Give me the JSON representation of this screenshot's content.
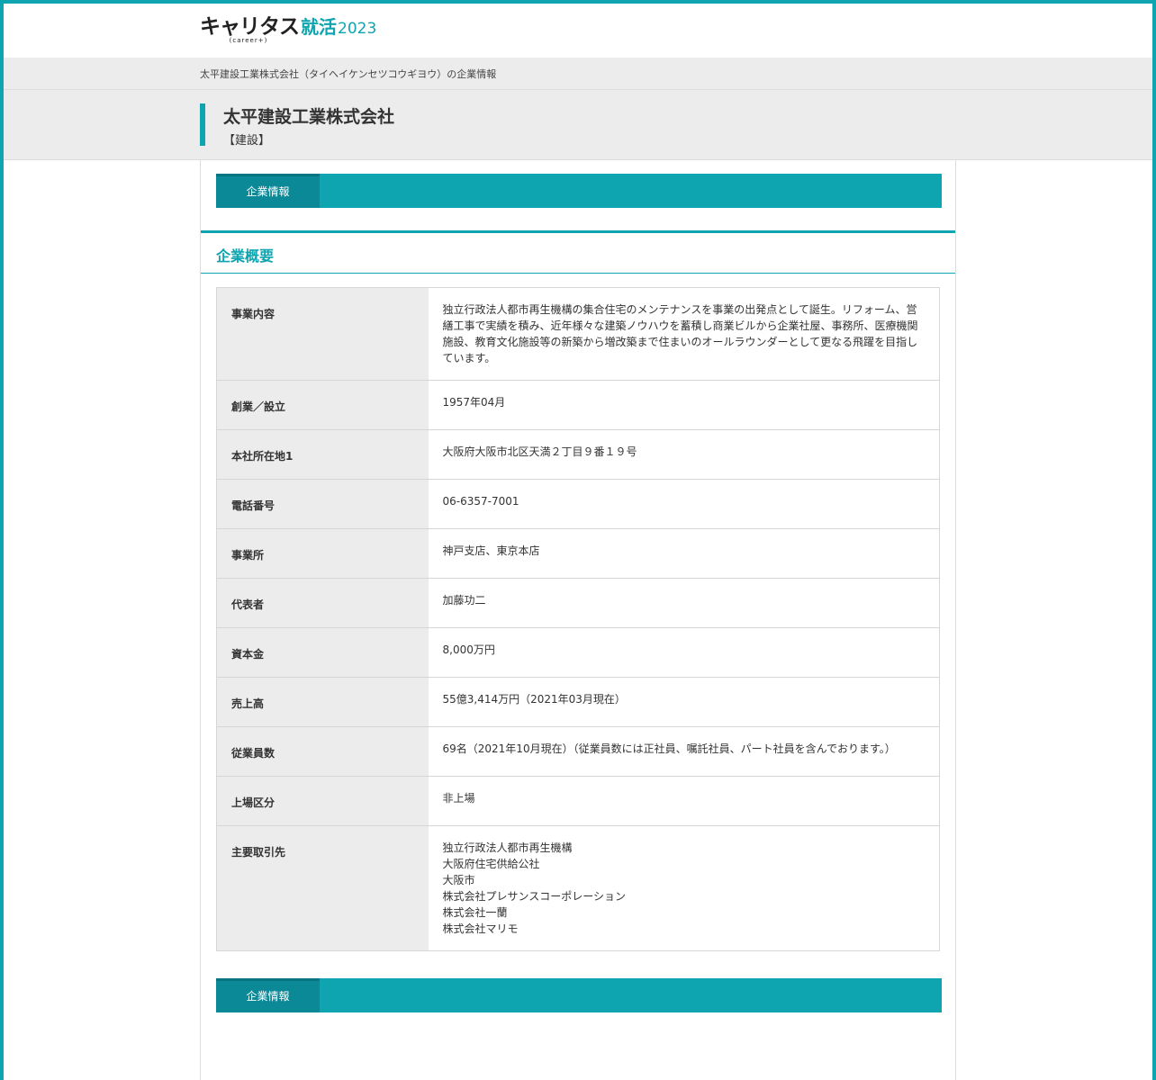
{
  "header": {
    "logo_main": "キャリタス",
    "logo_sub": "(career+)",
    "logo_accent": "就活",
    "logo_year": "2023"
  },
  "breadcrumb": "太平建設工業株式会社（タイヘイケンセツコウギヨウ）の企業情報",
  "company": {
    "name": "太平建設工業株式会社",
    "industry": "【建設】"
  },
  "tabs": {
    "top_label": "企業情報",
    "bottom_label": "企業情報"
  },
  "section": {
    "title": "企業概要"
  },
  "overview": {
    "rows": [
      {
        "label": "事業内容",
        "lines": [
          "独立行政法人都市再生機構の集合住宅のメンテナンスを事業の出発点として誕生。リフォーム、営",
          "繕工事で実績を積み、近年様々な建築ノウハウを蓄積し商業ビルから企業社屋、事務所、医療機関",
          "施設、教育文化施設等の新築から増改築まで住まいのオールラウンダーとして更なる飛躍を目指し",
          "ています。"
        ]
      },
      {
        "label": "創業／設立",
        "lines": [
          "1957年04月"
        ]
      },
      {
        "label": "本社所在地1",
        "lines": [
          "大阪府大阪市北区天満２丁目９番１９号"
        ]
      },
      {
        "label": "電話番号",
        "lines": [
          "06-6357-7001"
        ]
      },
      {
        "label": "事業所",
        "lines": [
          "神戸支店、東京本店"
        ]
      },
      {
        "label": "代表者",
        "lines": [
          "加藤功二"
        ]
      },
      {
        "label": "資本金",
        "lines": [
          "8,000万円"
        ]
      },
      {
        "label": "売上高",
        "lines": [
          "55億3,414万円（2021年03月現在）"
        ]
      },
      {
        "label": "従業員数",
        "lines": [
          "69名（2021年10月現在）（従業員数には正社員、嘱託社員、パート社員を含んでおります。）"
        ]
      },
      {
        "label": "上場区分",
        "lines": [
          "非上場"
        ]
      },
      {
        "label": "主要取引先",
        "lines": [
          "独立行政法人都市再生機構",
          "大阪府住宅供給公社",
          "大阪市",
          "株式会社プレサンスコーポレーション",
          "株式会社一蘭",
          "株式会社マリモ"
        ]
      }
    ]
  },
  "colors": {
    "accent": "#0ea5b0",
    "tab_active": "#0b8996",
    "label_bg": "#ececec"
  }
}
